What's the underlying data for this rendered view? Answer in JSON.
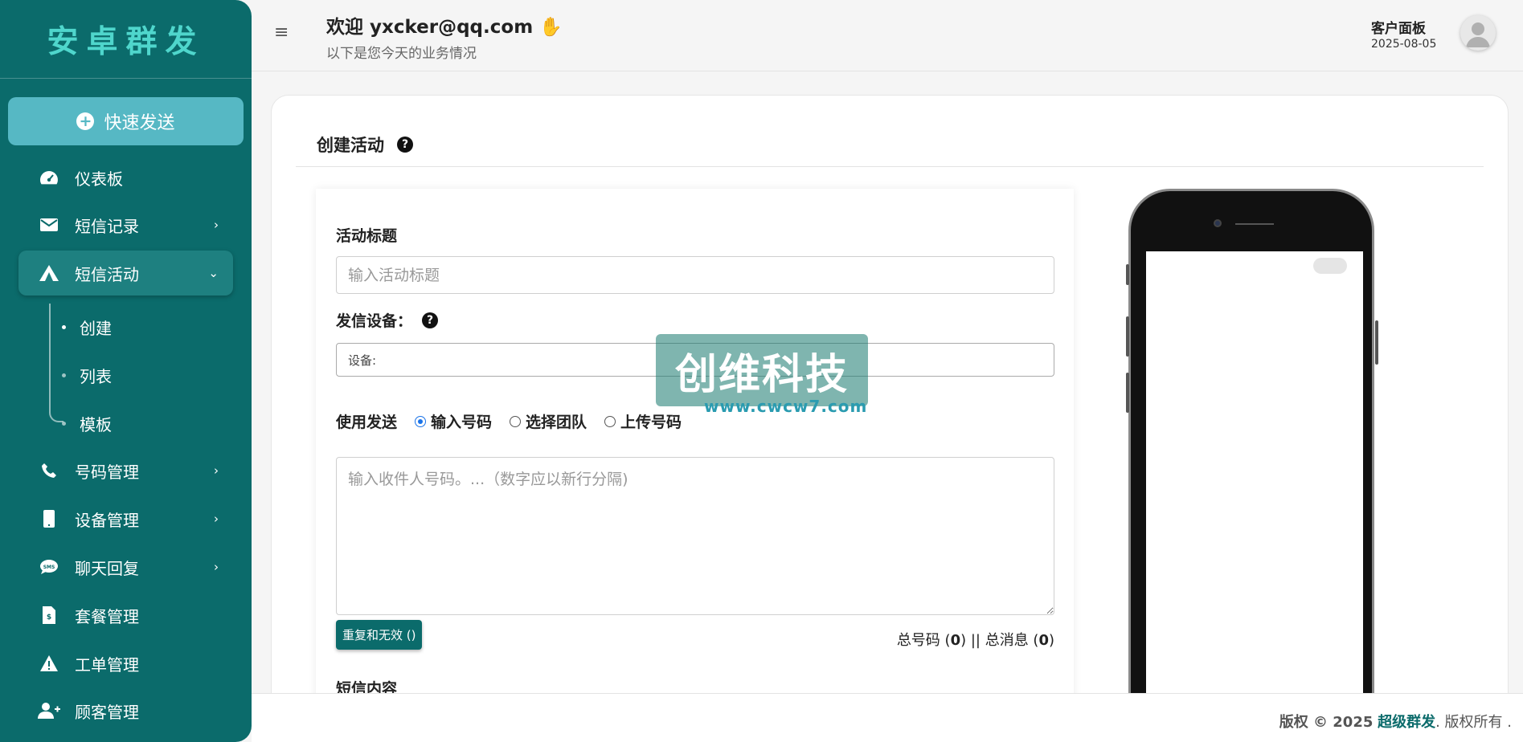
{
  "sidebar": {
    "brand": "安卓群发",
    "quick_send": "快速发送",
    "items": [
      {
        "label": "仪表板"
      },
      {
        "label": "短信记录"
      },
      {
        "label": "短信活动"
      },
      {
        "label": "号码管理"
      },
      {
        "label": "设备管理"
      },
      {
        "label": "聊天回复"
      },
      {
        "label": "套餐管理"
      },
      {
        "label": "工单管理"
      },
      {
        "label": "顾客管理"
      }
    ],
    "sub_items": [
      {
        "label": "创建"
      },
      {
        "label": "列表"
      },
      {
        "label": "模板"
      }
    ]
  },
  "header": {
    "welcome": "欢迎 yxcker@qq.com",
    "subtitle": "以下是您今天的业务情况",
    "panel_title": "客户面板",
    "date": "2025-08-05"
  },
  "card": {
    "title": "创建活动"
  },
  "form": {
    "campaign_title_label": "活动标题",
    "campaign_title_placeholder": "输入活动标题",
    "device_label": "发信设备：",
    "device_value": "设备:",
    "send_using_label": "使用发送",
    "options": [
      "输入号码",
      "选择团队",
      "上传号码"
    ],
    "recipients_placeholder": "输入收件人号码。...（数字应以新行分隔)",
    "dedupe_button": "重复和无效 ()",
    "totals_prefix": "总号码 (",
    "total_numbers": "0",
    "totals_mid": ") || 总消息 (",
    "total_messages": "0",
    "totals_suffix": ")",
    "sms_content_label": "短信内容"
  },
  "watermark": {
    "text": "创维科技",
    "url": "www.cwcw7.com"
  },
  "footer": {
    "prefix": "版权 © 2025",
    "brand": "超级群发",
    "suffix": ". 版权所有 ."
  },
  "colors": {
    "sidebar": "#0b6b6b",
    "brand_text": "#4fd6cc",
    "quick_send": "#56b8c4",
    "radio_checked": "#1a73e8"
  }
}
